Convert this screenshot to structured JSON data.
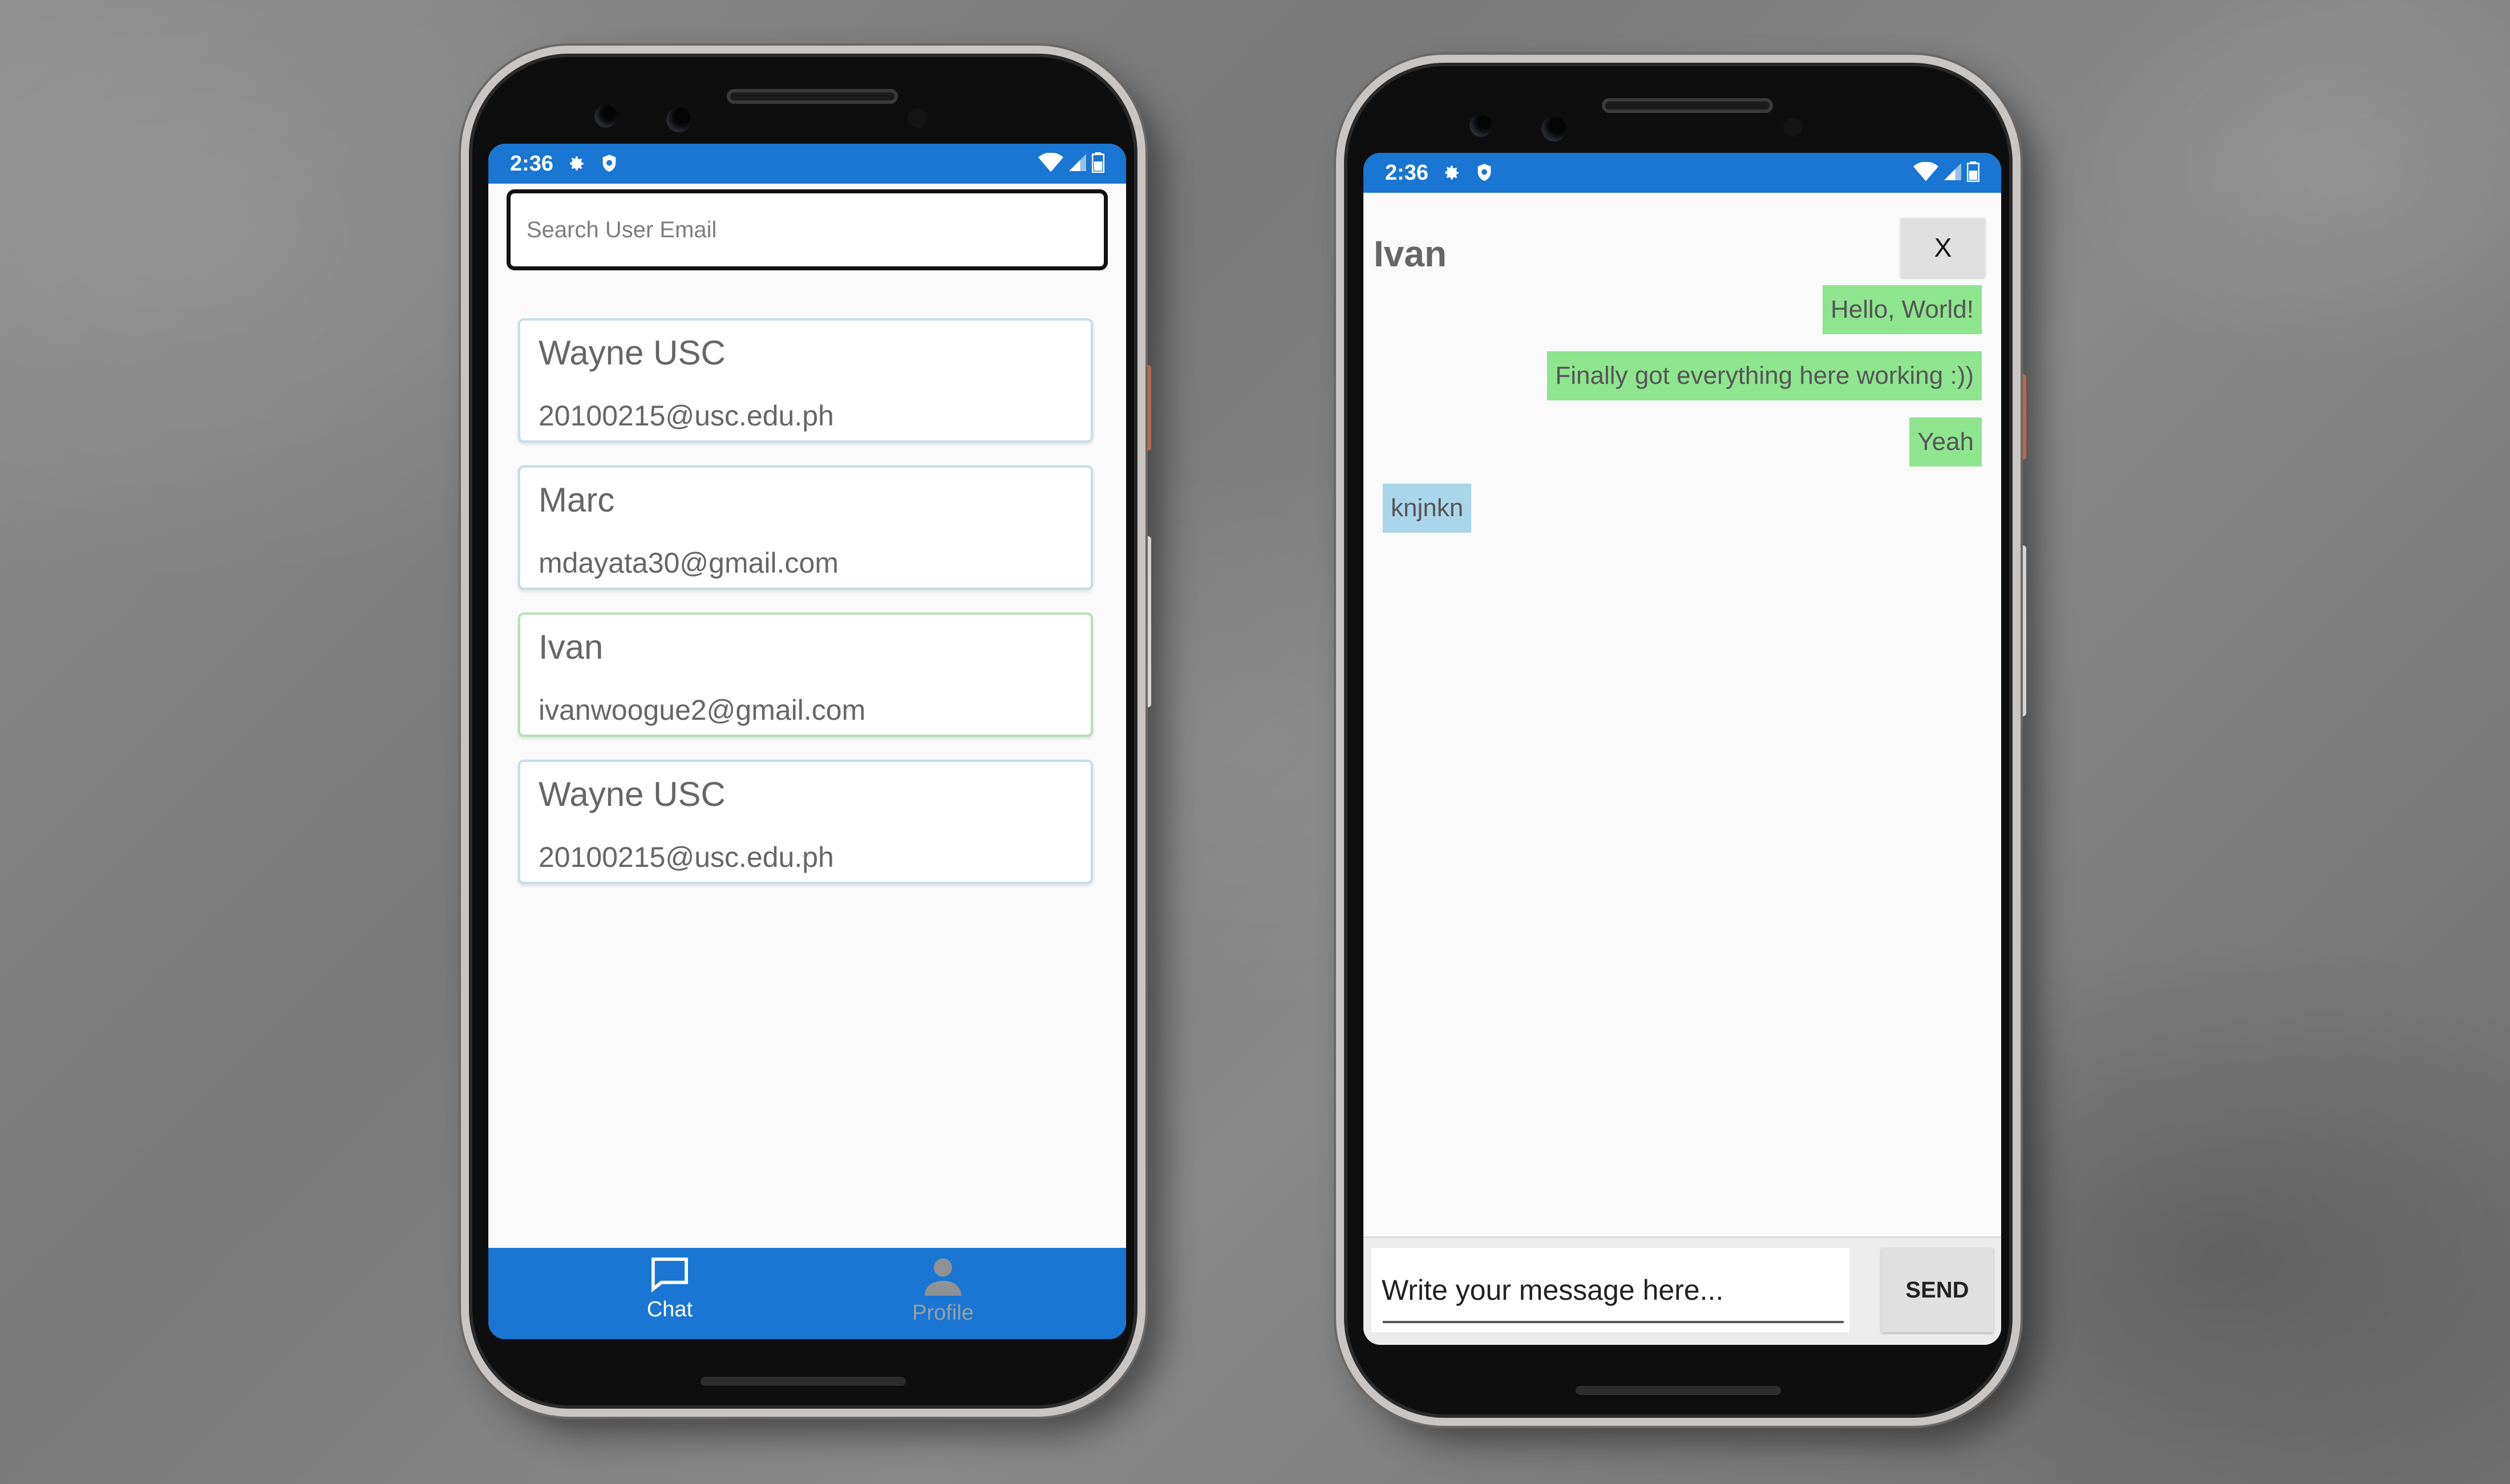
{
  "status_bar": {
    "time": "2:36"
  },
  "contacts_screen": {
    "search": {
      "placeholder": "Search User Email",
      "value": ""
    },
    "users": [
      {
        "name": "Wayne USC",
        "email": "20100215@usc.edu.ph",
        "selected": false
      },
      {
        "name": "Marc",
        "email": "mdayata30@gmail.com",
        "selected": false
      },
      {
        "name": "Ivan",
        "email": "ivanwoogue2@gmail.com",
        "selected": true
      },
      {
        "name": "Wayne USC",
        "email": "20100215@usc.edu.ph",
        "selected": false
      }
    ],
    "bottom_nav": {
      "chat_label": "Chat",
      "profile_label": "Profile",
      "active": "Chat"
    }
  },
  "chat_screen": {
    "title": "Ivan",
    "close_label": "X",
    "messages": [
      {
        "text": "Hello, World!",
        "direction": "sent"
      },
      {
        "text": "Finally got everything here working :))",
        "direction": "sent"
      },
      {
        "text": "Yeah",
        "direction": "sent"
      },
      {
        "text": "knjnkn",
        "direction": "received"
      }
    ],
    "input": {
      "placeholder": "Write your message here...",
      "value": ""
    },
    "send_label": "SEND"
  },
  "colors": {
    "primary": "#1976d2",
    "sent_bubble": "#8ee58e",
    "received_bubble": "#a9d6ea",
    "selected_card_border": "#b6e0b6",
    "card_border": "#c7dde9"
  },
  "icons": [
    "settings-gear-icon",
    "shield-icon",
    "wifi-icon",
    "signal-icon",
    "battery-icon",
    "chat-bubble-icon",
    "profile-person-icon"
  ]
}
